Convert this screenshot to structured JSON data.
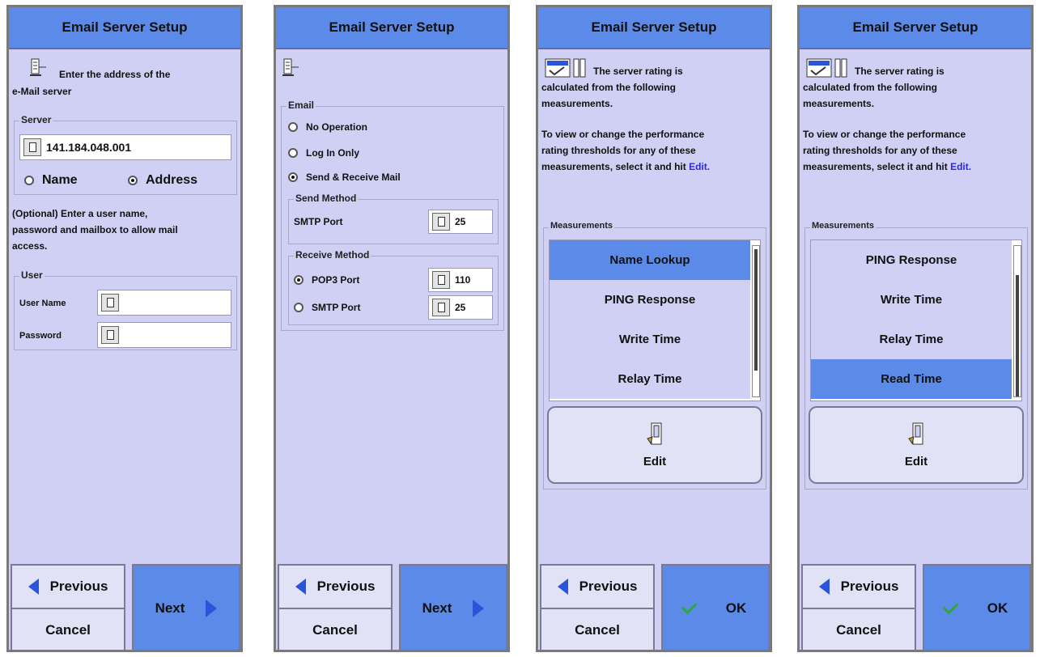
{
  "panels": [
    {
      "title": "Email Server Setup",
      "intro_line1": "Enter the address of the",
      "intro_line2": "e-Mail server",
      "server_group": "Server",
      "server_value": "141.184.048.001",
      "radio_name": "Name",
      "radio_address": "Address",
      "optional_line1": "(Optional) Enter a user name,",
      "optional_line2": "password and mailbox to allow mail",
      "optional_line3": "access.",
      "user_group": "User",
      "user_name_label": "User Name",
      "password_label": "Password",
      "previous": "Previous",
      "cancel": "Cancel",
      "next": "Next"
    },
    {
      "title": "Email Server Setup",
      "email_group": "Email",
      "opt_no_operation": "No Operation",
      "opt_log_in_only": "Log In Only",
      "opt_send_receive": "Send & Receive Mail",
      "send_method_group": "Send Method",
      "smtp_port_label": "SMTP Port",
      "smtp_port_value": "25",
      "receive_method_group": "Receive Method",
      "pop3_port_label": "POP3 Port",
      "pop3_port_value": "110",
      "recv_smtp_label": "SMTP Port",
      "recv_smtp_value": "25",
      "previous": "Previous",
      "cancel": "Cancel",
      "next": "Next"
    },
    {
      "title": "Email Server Setup",
      "intro_line1": "The server rating is",
      "intro_line2": "calculated from the following",
      "intro_line3": "measurements.",
      "view_line1": "To view or change the performance",
      "view_line2": "rating thresholds for any of these",
      "view_line3_pre": "measurements, select it and hit",
      "view_link": "Edit.",
      "measurements_group": "Measurements",
      "items": [
        "Name Lookup",
        "PING Response",
        "Write Time",
        "Relay Time"
      ],
      "selected_index": 0,
      "edit": "Edit",
      "previous": "Previous",
      "cancel": "Cancel",
      "ok": "OK"
    },
    {
      "title": "Email Server Setup",
      "intro_line1": "The server rating is",
      "intro_line2": "calculated from the following",
      "intro_line3": "measurements.",
      "view_line1": "To view or change the performance",
      "view_line2": "rating thresholds for any of these",
      "view_line3_pre": "measurements, select it and hit",
      "view_link": "Edit.",
      "measurements_group": "Measurements",
      "items": [
        "PING Response",
        "Write Time",
        "Relay Time",
        "Read Time"
      ],
      "selected_index": 3,
      "edit": "Edit",
      "previous": "Previous",
      "cancel": "Cancel",
      "ok": "OK"
    }
  ],
  "colors": {
    "panel_bg": "#d0d0f4",
    "accent": "#5b8ae8",
    "arrow": "#2a55d8",
    "check": "#2ca83c"
  }
}
